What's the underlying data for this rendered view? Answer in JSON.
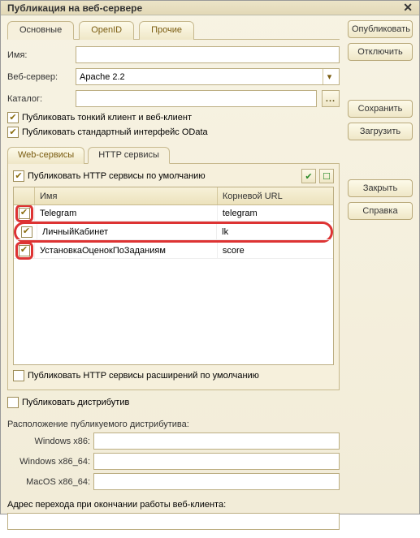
{
  "title": "Публикация на веб-сервере",
  "tabs": {
    "main": "Основные",
    "openid": "OpenID",
    "other": "Прочие"
  },
  "labels": {
    "name": "Имя:",
    "webserver": "Веб-сервер:",
    "catalog": "Каталог:",
    "publish_thin": "Публиковать тонкий клиент и веб-клиент",
    "publish_odata": "Публиковать стандартный интерфейс OData",
    "web_services_tab": "Web-сервисы",
    "http_services_tab": "HTTP сервисы",
    "publish_http_default": "Публиковать HTTP сервисы по умолчанию",
    "grid_name": "Имя",
    "grid_url": "Корневой URL",
    "publish_http_ext": "Публиковать HTTP сервисы расширений по умолчанию",
    "publish_dist": "Публиковать дистрибутив",
    "dist_location": "Расположение публикуемого дистрибутива:",
    "win86": "Windows x86:",
    "win64": "Windows x86_64:",
    "mac64": "MacOS x86_64:",
    "exit_addr": "Адрес перехода при окончании работы веб-клиента:"
  },
  "values": {
    "name": "",
    "webserver": "Apache 2.2",
    "catalog": "",
    "win86": "",
    "win64": "",
    "mac64": "",
    "exit_addr": ""
  },
  "checks": {
    "thin": "✔",
    "odata": "✔",
    "http_default": "✔",
    "http_ext": "",
    "dist": ""
  },
  "http_rows": [
    {
      "name": "Telegram",
      "url": "telegram",
      "checked": "✔"
    },
    {
      "name": "ЛичныйКабинет",
      "url": "lk",
      "checked": "✔"
    },
    {
      "name": "УстановкаОценокПоЗаданиям",
      "url": "score",
      "checked": "✔"
    }
  ],
  "buttons": {
    "publish": "Опубликовать",
    "disconnect": "Отключить",
    "save": "Сохранить",
    "load": "Загрузить",
    "close": "Закрыть",
    "help": "Справка"
  },
  "icons": {
    "dots": "...",
    "close": "✕",
    "dd": "▾",
    "check_all": "✔",
    "uncheck_all": "☐"
  }
}
